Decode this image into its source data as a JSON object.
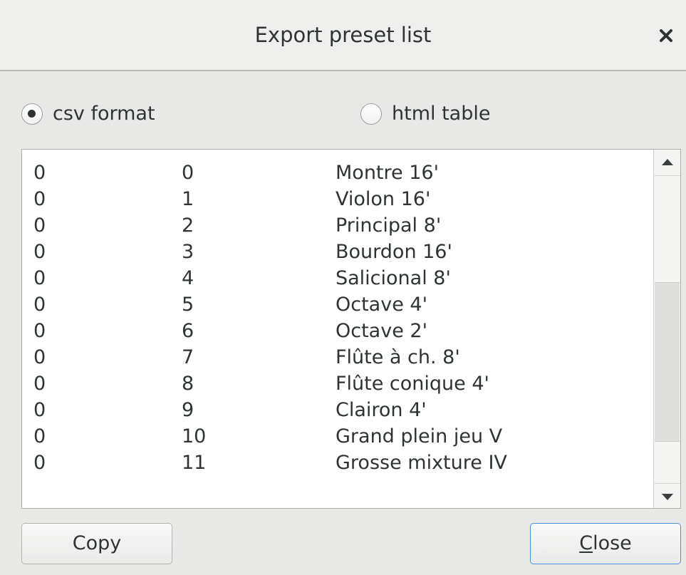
{
  "dialog": {
    "title": "Export preset list"
  },
  "format": {
    "options": [
      {
        "label": "csv format",
        "checked": true
      },
      {
        "label": "html table",
        "checked": false
      }
    ]
  },
  "presets": {
    "rows": [
      [
        "0",
        "0",
        "Montre 16'"
      ],
      [
        "0",
        "1",
        "Violon 16'"
      ],
      [
        "0",
        "2",
        "Principal 8'"
      ],
      [
        "0",
        "3",
        "Bourdon 16'"
      ],
      [
        "0",
        "4",
        "Salicional 8'"
      ],
      [
        "0",
        "5",
        "Octave 4'"
      ],
      [
        "0",
        "6",
        "Octave 2'"
      ],
      [
        "0",
        "7",
        "Flûte à ch. 8'"
      ],
      [
        "0",
        "8",
        "Flûte conique 4'"
      ],
      [
        "0",
        "9",
        "Clairon 4'"
      ],
      [
        "0",
        "10",
        "Grand plein jeu V"
      ],
      [
        "0",
        "11",
        "Grosse mixture IV"
      ]
    ],
    "scroll_position": 0.72
  },
  "buttons": {
    "copy_label": "Copy",
    "close_mnemonic": "C",
    "close_rest": "lose"
  },
  "colors": {
    "focus_border": "#4a90d9"
  },
  "icons": {
    "close": "close-icon",
    "scroll_up": "scroll-up-arrow-icon",
    "scroll_down": "scroll-down-arrow-icon"
  }
}
